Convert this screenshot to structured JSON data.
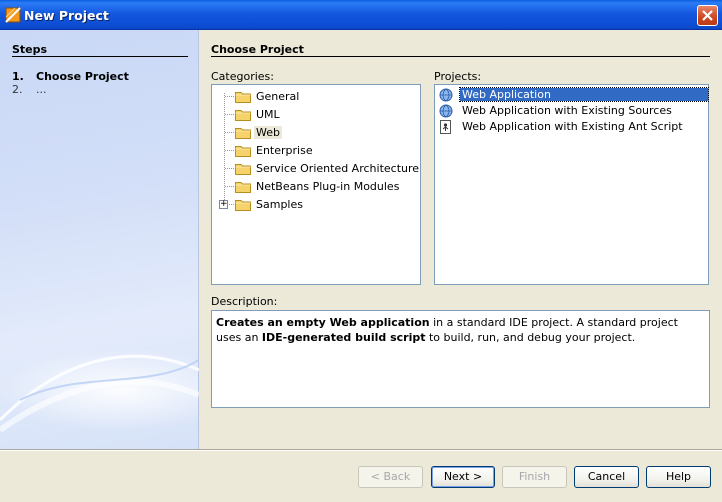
{
  "window": {
    "title": "New Project"
  },
  "steps": {
    "heading": "Steps",
    "items": [
      {
        "num": "1.",
        "label": "Choose Project"
      },
      {
        "num": "2.",
        "label": "..."
      }
    ]
  },
  "main": {
    "heading": "Choose Project",
    "categories_label": "Categories:",
    "projects_label": "Projects:",
    "description_label": "Description:"
  },
  "categories": [
    {
      "label": "General"
    },
    {
      "label": "UML"
    },
    {
      "label": "Web",
      "selected": true
    },
    {
      "label": "Enterprise"
    },
    {
      "label": "Service Oriented Architecture"
    },
    {
      "label": "NetBeans Plug-in Modules"
    },
    {
      "label": "Samples",
      "expandable": true
    }
  ],
  "projects": [
    {
      "label": "Web Application",
      "icon": "globe-icon",
      "selected": true
    },
    {
      "label": "Web Application with Existing Sources",
      "icon": "globe-icon"
    },
    {
      "label": "Web Application with Existing Ant Script",
      "icon": "ant-script-icon"
    }
  ],
  "description": {
    "part1_bold": "Creates an empty Web application",
    "part2": " in a standard IDE project. A standard project uses an ",
    "part3_bold": "IDE-generated build script",
    "part4": " to build, run, and debug your project."
  },
  "buttons": {
    "back": "< Back",
    "next": "Next >",
    "finish": "Finish",
    "cancel": "Cancel",
    "help": "Help"
  },
  "colors": {
    "titlebar": "#0E4FD6",
    "selection": "#316AC5",
    "dialog_bg": "#ECE9D8",
    "steps_bg": "#D3DFF8"
  }
}
